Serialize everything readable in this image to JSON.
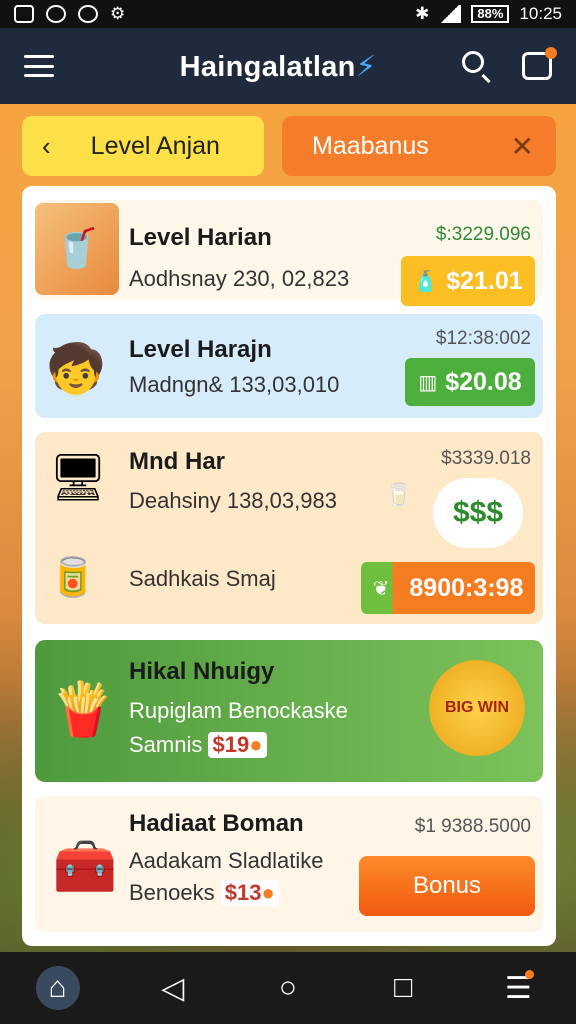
{
  "status": {
    "battery": "88%",
    "time": "10:25"
  },
  "app_bar": {
    "title": "Haingalatlan"
  },
  "tabs": {
    "level_label": "Level Anjan",
    "bonus_label": "Maabanus"
  },
  "cards": [
    {
      "title": "Level Harian",
      "subtitle": "Aodhsnay 230, 02,823",
      "price": "$:3229.096",
      "button": "$21.01"
    },
    {
      "title": "Level Harajn",
      "subtitle": "Madngn& 133,03,010",
      "price": "$12:38:002",
      "button": "$20.08"
    },
    {
      "title": "Mnd Har",
      "subtitle": "Deahsiny 138,03,983",
      "price": "$3339.018",
      "sub2": "Sadhkais Smaj",
      "bubble": "$$$",
      "button": "8900:3:98"
    },
    {
      "title": "Hikal Nhuigy",
      "subtitle": "Rupiglam Benockaske",
      "sub2": "Samnis",
      "badge": "$19",
      "medal": "BIG WIN"
    },
    {
      "title": "Hadiaat Boman",
      "subtitle": "Aadakam Sladlatike",
      "sub2": "Benoeks",
      "badge": "$13",
      "price": "$1 9388.5000",
      "button": "Bonus"
    }
  ],
  "icons": {
    "menu": "hamburger-icon",
    "search": "search-icon",
    "chat": "chat-icon",
    "back": "back-triangle-icon",
    "home_circle": "home-circle-icon",
    "recents": "recents-square-icon"
  }
}
